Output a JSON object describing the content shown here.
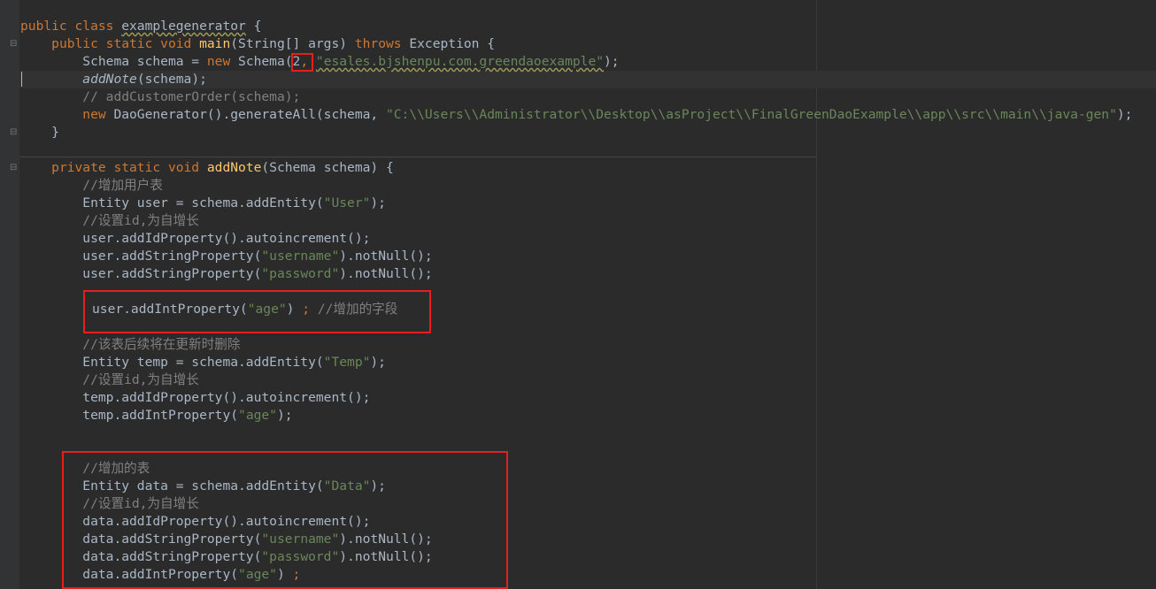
{
  "editor": {
    "class_decl": {
      "kw": "public class ",
      "name": "examplegenerator",
      "brace": " {"
    },
    "main_sig": {
      "indent": "    ",
      "kw": "public static void ",
      "fn": "main",
      "params": "(String[] args) ",
      "throws": "throws",
      "exc": " Exception {"
    },
    "schema_line": {
      "indent": "        ",
      "pre": "Schema schema = ",
      "kw_new": "new",
      "ctor": " Schema(",
      "version": "2",
      "comma": ", ",
      "pkg": "\"esales.bjshenpu.com.greendaoexample\"",
      "end": ");"
    },
    "add_note_call": {
      "indent": "        ",
      "fn": "addNote",
      "args": "(schema);"
    },
    "comment_customer_order": {
      "indent": "        ",
      "text": "// addCustomerOrder(schema);"
    },
    "generate_line": {
      "indent": "        ",
      "kw_new": "new",
      "call": " DaoGenerator().generateAll(schema, ",
      "path": "\"C:\\\\Users\\\\Administrator\\\\Desktop\\\\asProject\\\\FinalGreenDaoExample\\\\app\\\\src\\\\main\\\\java-gen\"",
      "end": ");"
    },
    "main_close": "    }",
    "add_note_sig": {
      "indent": "    ",
      "kw": "private static void ",
      "fn": "addNote",
      "params": "(Schema schema) {"
    },
    "user_block": {
      "indent": "        ",
      "comment1": "//增加用户表",
      "entity_pre": "Entity user = schema.addEntity(",
      "entity_str": "\"User\"",
      "entity_end": ");",
      "comment2": "//设置id,为自增长",
      "id_line": "user.addIdProperty().autoincrement();",
      "username_pre": "user.addStringProperty(",
      "username_str": "\"username\"",
      "username_end": ").notNull();",
      "password_pre": "user.addStringProperty(",
      "password_str": "\"password\"",
      "password_end": ").notNull();",
      "age_pre": "user.addIntProperty(",
      "age_str": "\"age\"",
      "age_mid": ") ",
      "age_semi": ";",
      "age_comment": " //增加的字段"
    },
    "temp_block": {
      "indent": "        ",
      "comment1": "//该表后续将在更新时删除",
      "entity_pre": "Entity temp = schema.addEntity(",
      "entity_str": "\"Temp\"",
      "entity_end": ");",
      "comment2": "//设置id,为自增长",
      "id_line": "temp.addIdProperty().autoincrement();",
      "age_pre": "temp.addIntProperty(",
      "age_str": "\"age\"",
      "age_end": ");"
    },
    "data_block": {
      "indent": "        ",
      "comment1": "//增加的表",
      "entity_pre": "Entity data = schema.addEntity(",
      "entity_str": "\"Data\"",
      "entity_end": ");",
      "comment2": "//设置id,为自增长",
      "id_line": "data.addIdProperty().autoincrement();",
      "username_pre": "data.addStringProperty(",
      "username_str": "\"username\"",
      "username_end": ").notNull();",
      "password_pre": "data.addStringProperty(",
      "password_str": "\"password\"",
      "password_end": ").notNull();",
      "age_pre": "data.addIntProperty(",
      "age_str": "\"age\"",
      "age_mid": ") ",
      "age_semi": ";"
    }
  },
  "theme": {
    "background": "#2b2b2b",
    "keyword": "#cc7832",
    "string": "#6a8759",
    "function": "#ffc66d",
    "comment": "#808080",
    "text": "#a9b7c6",
    "highlight_box": "#e61e1e"
  }
}
